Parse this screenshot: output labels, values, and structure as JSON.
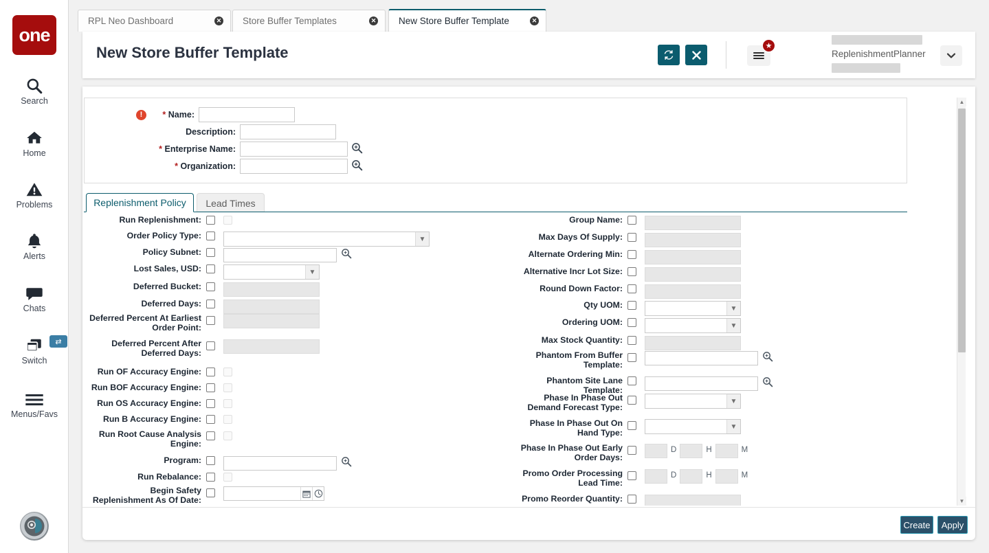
{
  "sidebar": {
    "logo_text": "one",
    "items": [
      {
        "label": "Search",
        "icon": "search-icon"
      },
      {
        "label": "Home",
        "icon": "home-icon"
      },
      {
        "label": "Problems",
        "icon": "warning-icon"
      },
      {
        "label": "Alerts",
        "icon": "bell-icon"
      },
      {
        "label": "Chats",
        "icon": "chat-icon"
      },
      {
        "label": "Switch",
        "icon": "switch-windows-icon"
      },
      {
        "label": "Menus/Favs",
        "icon": "hamburger-icon"
      }
    ],
    "switch_badge": "⇄"
  },
  "tabs": [
    {
      "label": "RPL Neo Dashboard",
      "active": false
    },
    {
      "label": "Store Buffer Templates",
      "active": false
    },
    {
      "label": "New Store Buffer Template",
      "active": true
    }
  ],
  "header": {
    "title": "New Store Buffer Template",
    "refresh_icon": "refresh-icon",
    "close_icon": "close-icon",
    "menu_icon": "hamburger-menu-icon",
    "favorites_badge_icon": "star-icon",
    "user_name": "ReplenishmentPlanner",
    "user_chevron_icon": "chevron-down-icon"
  },
  "top_form": {
    "fields": [
      {
        "label": "Name:",
        "required": true,
        "has_alert": true,
        "value": "",
        "control": "text"
      },
      {
        "label": "Description:",
        "required": false,
        "has_alert": false,
        "value": "",
        "control": "text"
      },
      {
        "label": "Enterprise Name:",
        "required": true,
        "has_alert": false,
        "value": "",
        "control": "lookup"
      },
      {
        "label": "Organization:",
        "required": true,
        "has_alert": false,
        "value": "",
        "control": "lookup"
      }
    ]
  },
  "inner_tabs": [
    {
      "label": "Replenishment Policy",
      "active": true
    },
    {
      "label": "Lead Times",
      "active": false
    }
  ],
  "left_column": [
    {
      "label": "Run Replenishment:",
      "control": "checkbox-disabled",
      "value": ""
    },
    {
      "label": "Order Policy Type:",
      "control": "select-wide",
      "value": ""
    },
    {
      "label": "Policy Subnet:",
      "control": "lookup",
      "value": ""
    },
    {
      "label": "Lost Sales, USD:",
      "control": "select-narrow",
      "value": ""
    },
    {
      "label": "Deferred Bucket:",
      "control": "input-disabled",
      "value": ""
    },
    {
      "label": "Deferred Days:",
      "control": "input-disabled",
      "value": ""
    },
    {
      "label": "Deferred Percent At Earliest Order Point:",
      "control": "input-disabled",
      "value": ""
    },
    {
      "label": "Deferred Percent After Deferred Days:",
      "control": "input-disabled",
      "value": ""
    },
    {
      "label": "Run OF Accuracy Engine:",
      "control": "checkbox-disabled",
      "value": ""
    },
    {
      "label": "Run BOF Accuracy Engine:",
      "control": "checkbox-disabled",
      "value": ""
    },
    {
      "label": "Run OS Accuracy Engine:",
      "control": "checkbox-disabled",
      "value": ""
    },
    {
      "label": "Run B Accuracy Engine:",
      "control": "checkbox-disabled",
      "value": ""
    },
    {
      "label": "Run Root Cause Analysis Engine:",
      "control": "checkbox-disabled",
      "value": ""
    },
    {
      "label": "Program:",
      "control": "lookup",
      "value": ""
    },
    {
      "label": "Run Rebalance:",
      "control": "checkbox-disabled",
      "value": ""
    },
    {
      "label": "Begin Safety Replenishment As Of Date:",
      "control": "datetime",
      "value": ""
    }
  ],
  "right_column": [
    {
      "label": "Group Name:",
      "control": "input-disabled",
      "value": ""
    },
    {
      "label": "Max Days Of Supply:",
      "control": "input-disabled",
      "value": ""
    },
    {
      "label": "Alternate Ordering Min:",
      "control": "input-disabled",
      "value": ""
    },
    {
      "label": "Alternative Incr Lot Size:",
      "control": "input-disabled",
      "value": ""
    },
    {
      "label": "Round Down Factor:",
      "control": "input-disabled",
      "value": ""
    },
    {
      "label": "Qty UOM:",
      "control": "select",
      "value": ""
    },
    {
      "label": "Ordering UOM:",
      "control": "select",
      "value": ""
    },
    {
      "label": "Max Stock Quantity:",
      "control": "input-disabled",
      "value": ""
    },
    {
      "label": "Phantom From Buffer Template:",
      "control": "lookup",
      "value": ""
    },
    {
      "label": "Phantom Site Lane Template:",
      "control": "lookup",
      "value": ""
    },
    {
      "label": "Phase In Phase Out Demand Forecast Type:",
      "control": "select",
      "value": ""
    },
    {
      "label": "Phase In Phase Out On Hand Type:",
      "control": "select",
      "value": ""
    },
    {
      "label": "Phase In Phase Out Early Order Days:",
      "control": "dhm",
      "value": ""
    },
    {
      "label": "Promo Order Processing Lead Time:",
      "control": "dhm",
      "value": ""
    },
    {
      "label": "Promo Reorder Quantity:",
      "control": "input-disabled",
      "value": ""
    }
  ],
  "duration_units": {
    "days": "D",
    "hours": "H",
    "minutes": "M"
  },
  "footer": {
    "create_label": "Create",
    "apply_label": "Apply"
  },
  "scrollbar": {
    "up_icon": "caret-up-icon",
    "down_icon": "caret-down-icon"
  },
  "colors": {
    "brand_red": "#a50d0d",
    "teal": "#0b5c6e",
    "button_navy": "#2b5069",
    "button_border": "#2b9ab3",
    "alert_red": "#e0452d"
  }
}
